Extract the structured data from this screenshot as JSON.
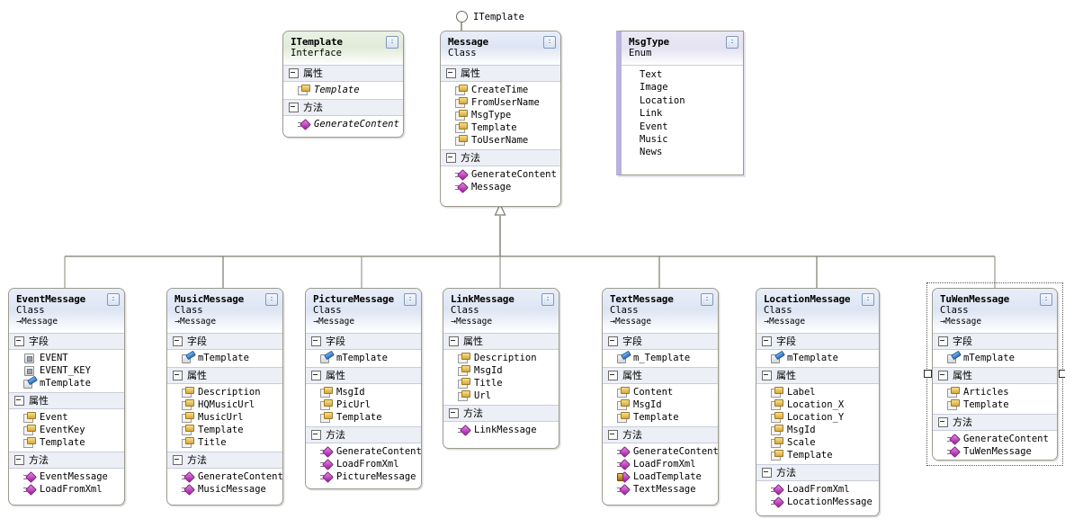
{
  "diagram": {
    "type": "uml-class-diagram",
    "section_labels": {
      "fields": "字段",
      "properties": "属性",
      "methods": "方法"
    },
    "interface_lollipop": {
      "label": "ITemplate"
    },
    "colors": {
      "class_header": "#dde5f4",
      "interface_header": "#e2ebd9",
      "enum_header": "#e4e1f1",
      "section_band": "#eceff5",
      "border": "#9a9a8e",
      "connector": "#7a7a6e",
      "method_icon": "#a018a0",
      "property_icon": "#d8a83c",
      "field_key_icon": "#1f6fc4"
    }
  },
  "nodes": [
    {
      "id": "itemplate",
      "name": "ITemplate",
      "kind": "Interface",
      "stereotype": "iface",
      "base": "",
      "sections": [
        {
          "label": "属性",
          "members": [
            {
              "name": "Template",
              "icon": "property-icon",
              "italic": true
            }
          ]
        },
        {
          "label": "方法",
          "members": [
            {
              "name": "GenerateContent",
              "icon": "method-icon",
              "italic": true
            }
          ]
        }
      ]
    },
    {
      "id": "message",
      "name": "Message",
      "kind": "Class",
      "stereotype": "cls",
      "base": "",
      "sections": [
        {
          "label": "属性",
          "members": [
            {
              "name": "CreateTime",
              "icon": "property-icon"
            },
            {
              "name": "FromUserName",
              "icon": "property-icon"
            },
            {
              "name": "MsgType",
              "icon": "property-icon"
            },
            {
              "name": "Template",
              "icon": "property-icon"
            },
            {
              "name": "ToUserName",
              "icon": "property-icon"
            }
          ]
        },
        {
          "label": "方法",
          "members": [
            {
              "name": "GenerateContent",
              "icon": "method-icon"
            },
            {
              "name": "Message",
              "icon": "method-icon"
            }
          ]
        }
      ]
    },
    {
      "id": "msgtype",
      "name": "MsgType",
      "kind": "Enum",
      "stereotype": "enum",
      "base": "",
      "literals": [
        "Text",
        "Image",
        "Location",
        "Link",
        "Event",
        "Music",
        "News"
      ]
    },
    {
      "id": "eventmessage",
      "name": "EventMessage",
      "kind": "Class",
      "stereotype": "cls",
      "base": "Message",
      "sections": [
        {
          "label": "字段",
          "members": [
            {
              "name": "EVENT",
              "icon": "field-icon"
            },
            {
              "name": "EVENT_KEY",
              "icon": "field-icon"
            },
            {
              "name": "mTemplate",
              "icon": "field-key-icon"
            }
          ]
        },
        {
          "label": "属性",
          "members": [
            {
              "name": "Event",
              "icon": "property-icon"
            },
            {
              "name": "EventKey",
              "icon": "property-icon"
            },
            {
              "name": "Template",
              "icon": "property-icon"
            }
          ]
        },
        {
          "label": "方法",
          "members": [
            {
              "name": "EventMessage",
              "icon": "method-icon"
            },
            {
              "name": "LoadFromXml",
              "icon": "method-icon"
            }
          ]
        }
      ]
    },
    {
      "id": "musicmessage",
      "name": "MusicMessage",
      "kind": "Class",
      "stereotype": "cls",
      "base": "Message",
      "sections": [
        {
          "label": "字段",
          "members": [
            {
              "name": "mTemplate",
              "icon": "field-key-icon"
            }
          ]
        },
        {
          "label": "属性",
          "members": [
            {
              "name": "Description",
              "icon": "property-icon"
            },
            {
              "name": "HQMusicUrl",
              "icon": "property-icon"
            },
            {
              "name": "MusicUrl",
              "icon": "property-icon"
            },
            {
              "name": "Template",
              "icon": "property-icon"
            },
            {
              "name": "Title",
              "icon": "property-icon"
            }
          ]
        },
        {
          "label": "方法",
          "members": [
            {
              "name": "GenerateContent",
              "icon": "method-icon"
            },
            {
              "name": "MusicMessage",
              "icon": "method-icon"
            }
          ]
        }
      ]
    },
    {
      "id": "picturemessage",
      "name": "PictureMessage",
      "kind": "Class",
      "stereotype": "cls",
      "base": "Message",
      "sections": [
        {
          "label": "字段",
          "members": [
            {
              "name": "mTemplate",
              "icon": "field-key-icon"
            }
          ]
        },
        {
          "label": "属性",
          "members": [
            {
              "name": "MsgId",
              "icon": "property-icon"
            },
            {
              "name": "PicUrl",
              "icon": "property-icon"
            },
            {
              "name": "Template",
              "icon": "property-icon"
            }
          ]
        },
        {
          "label": "方法",
          "members": [
            {
              "name": "GenerateContent",
              "icon": "method-icon"
            },
            {
              "name": "LoadFromXml",
              "icon": "method-icon"
            },
            {
              "name": "PictureMessage",
              "icon": "method-icon"
            }
          ]
        }
      ]
    },
    {
      "id": "linkmessage",
      "name": "LinkMessage",
      "kind": "Class",
      "stereotype": "cls",
      "base": "Message",
      "sections": [
        {
          "label": "属性",
          "members": [
            {
              "name": "Description",
              "icon": "property-icon"
            },
            {
              "name": "MsgId",
              "icon": "property-icon"
            },
            {
              "name": "Title",
              "icon": "property-icon"
            },
            {
              "name": "Url",
              "icon": "property-icon"
            }
          ]
        },
        {
          "label": "方法",
          "members": [
            {
              "name": "LinkMessage",
              "icon": "method-icon"
            }
          ]
        }
      ]
    },
    {
      "id": "textmessage",
      "name": "TextMessage",
      "kind": "Class",
      "stereotype": "cls",
      "base": "Message",
      "sections": [
        {
          "label": "字段",
          "members": [
            {
              "name": "m_Template",
              "icon": "field-key-icon"
            }
          ]
        },
        {
          "label": "属性",
          "members": [
            {
              "name": "Content",
              "icon": "property-icon"
            },
            {
              "name": "MsgId",
              "icon": "property-icon"
            },
            {
              "name": "Template",
              "icon": "property-icon"
            }
          ]
        },
        {
          "label": "方法",
          "members": [
            {
              "name": "GenerateContent",
              "icon": "method-icon"
            },
            {
              "name": "LoadFromXml",
              "icon": "method-icon"
            },
            {
              "name": "LoadTemplate",
              "icon": "method-private-icon"
            },
            {
              "name": "TextMessage",
              "icon": "method-icon"
            }
          ]
        }
      ]
    },
    {
      "id": "locationmessage",
      "name": "LocationMessage",
      "kind": "Class",
      "stereotype": "cls",
      "base": "Message",
      "sections": [
        {
          "label": "字段",
          "members": [
            {
              "name": "mTemplate",
              "icon": "field-key-icon"
            }
          ]
        },
        {
          "label": "属性",
          "members": [
            {
              "name": "Label",
              "icon": "property-icon"
            },
            {
              "name": "Location_X",
              "icon": "property-icon"
            },
            {
              "name": "Location_Y",
              "icon": "property-icon"
            },
            {
              "name": "MsgId",
              "icon": "property-icon"
            },
            {
              "name": "Scale",
              "icon": "property-icon"
            },
            {
              "name": "Template",
              "icon": "property-icon"
            }
          ]
        },
        {
          "label": "方法",
          "members": [
            {
              "name": "LoadFromXml",
              "icon": "method-icon"
            },
            {
              "name": "LocationMessage",
              "icon": "method-icon"
            }
          ]
        }
      ]
    },
    {
      "id": "tuwenmessage",
      "name": "TuWenMessage",
      "kind": "Class",
      "stereotype": "cls",
      "base": "Message",
      "selected": true,
      "sections": [
        {
          "label": "字段",
          "members": [
            {
              "name": "mTemplate",
              "icon": "field-key-icon"
            }
          ]
        },
        {
          "label": "属性",
          "members": [
            {
              "name": "Articles",
              "icon": "property-icon"
            },
            {
              "name": "Template",
              "icon": "property-icon"
            }
          ]
        },
        {
          "label": "方法",
          "members": [
            {
              "name": "GenerateContent",
              "icon": "method-icon"
            },
            {
              "name": "TuWenMessage",
              "icon": "method-icon"
            }
          ]
        }
      ]
    }
  ]
}
